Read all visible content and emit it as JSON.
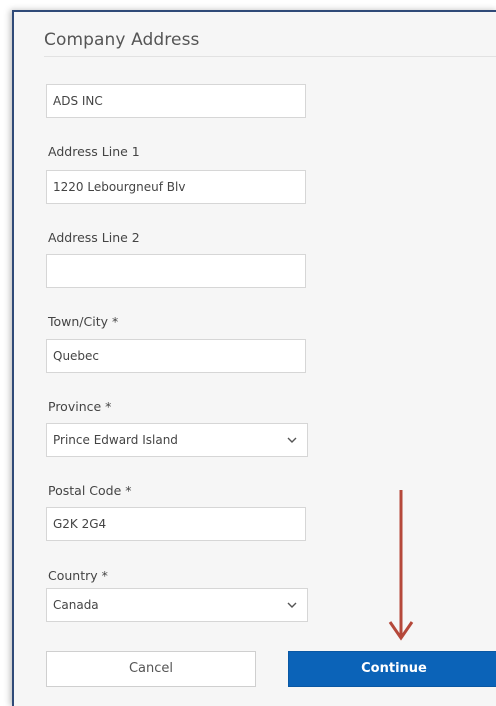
{
  "form": {
    "title": "Company Address",
    "company_name_value": "ADS INC",
    "address_line1_label": "Address Line 1",
    "address_line1_value": "1220 Lebourgneuf Blv",
    "address_line2_label": "Address Line 2",
    "address_line2_value": "",
    "town_label": "Town/City *",
    "town_value": "Quebec",
    "province_label": "Province *",
    "province_value": "Prince Edward Island",
    "postal_label": "Postal Code *",
    "postal_value": "G2K 2G4",
    "country_label": "Country *",
    "country_value": "Canada"
  },
  "buttons": {
    "cancel_label": "Cancel",
    "continue_label": "Continue"
  },
  "colors": {
    "primary": "#0b63b8",
    "annotation_arrow": "#b5483a",
    "frame_border": "#2f4a78"
  }
}
